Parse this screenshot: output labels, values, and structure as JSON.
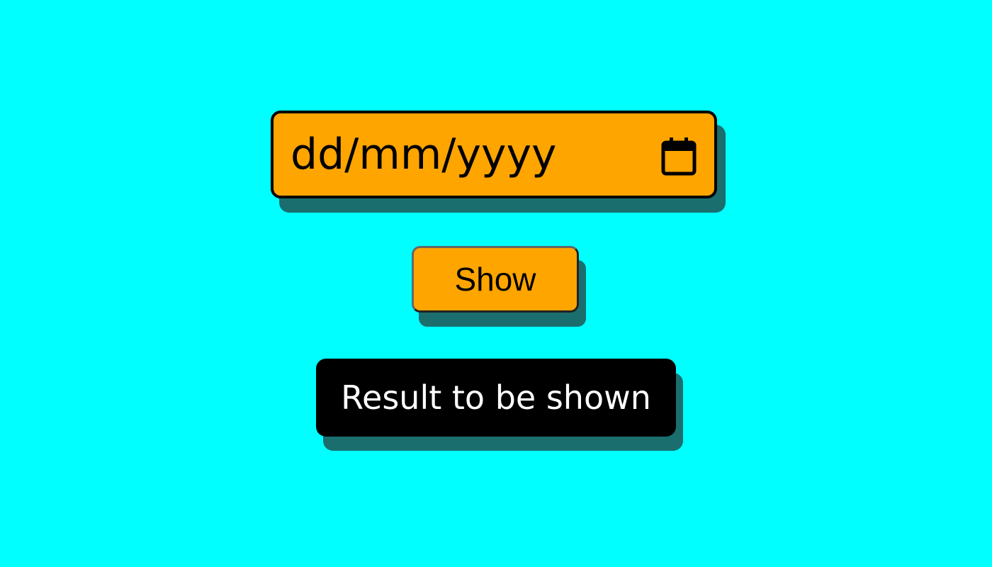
{
  "date_input": {
    "placeholder": "dd/mm/yyyy",
    "icon": "calendar-icon"
  },
  "show_button": {
    "label": "Show"
  },
  "result": {
    "text": "Result to be shown"
  },
  "colors": {
    "background": "#00ffff",
    "accent": "#ffa500",
    "shadow": "#1a6e6e",
    "result_bg": "#000000",
    "result_text": "#ffffff"
  }
}
